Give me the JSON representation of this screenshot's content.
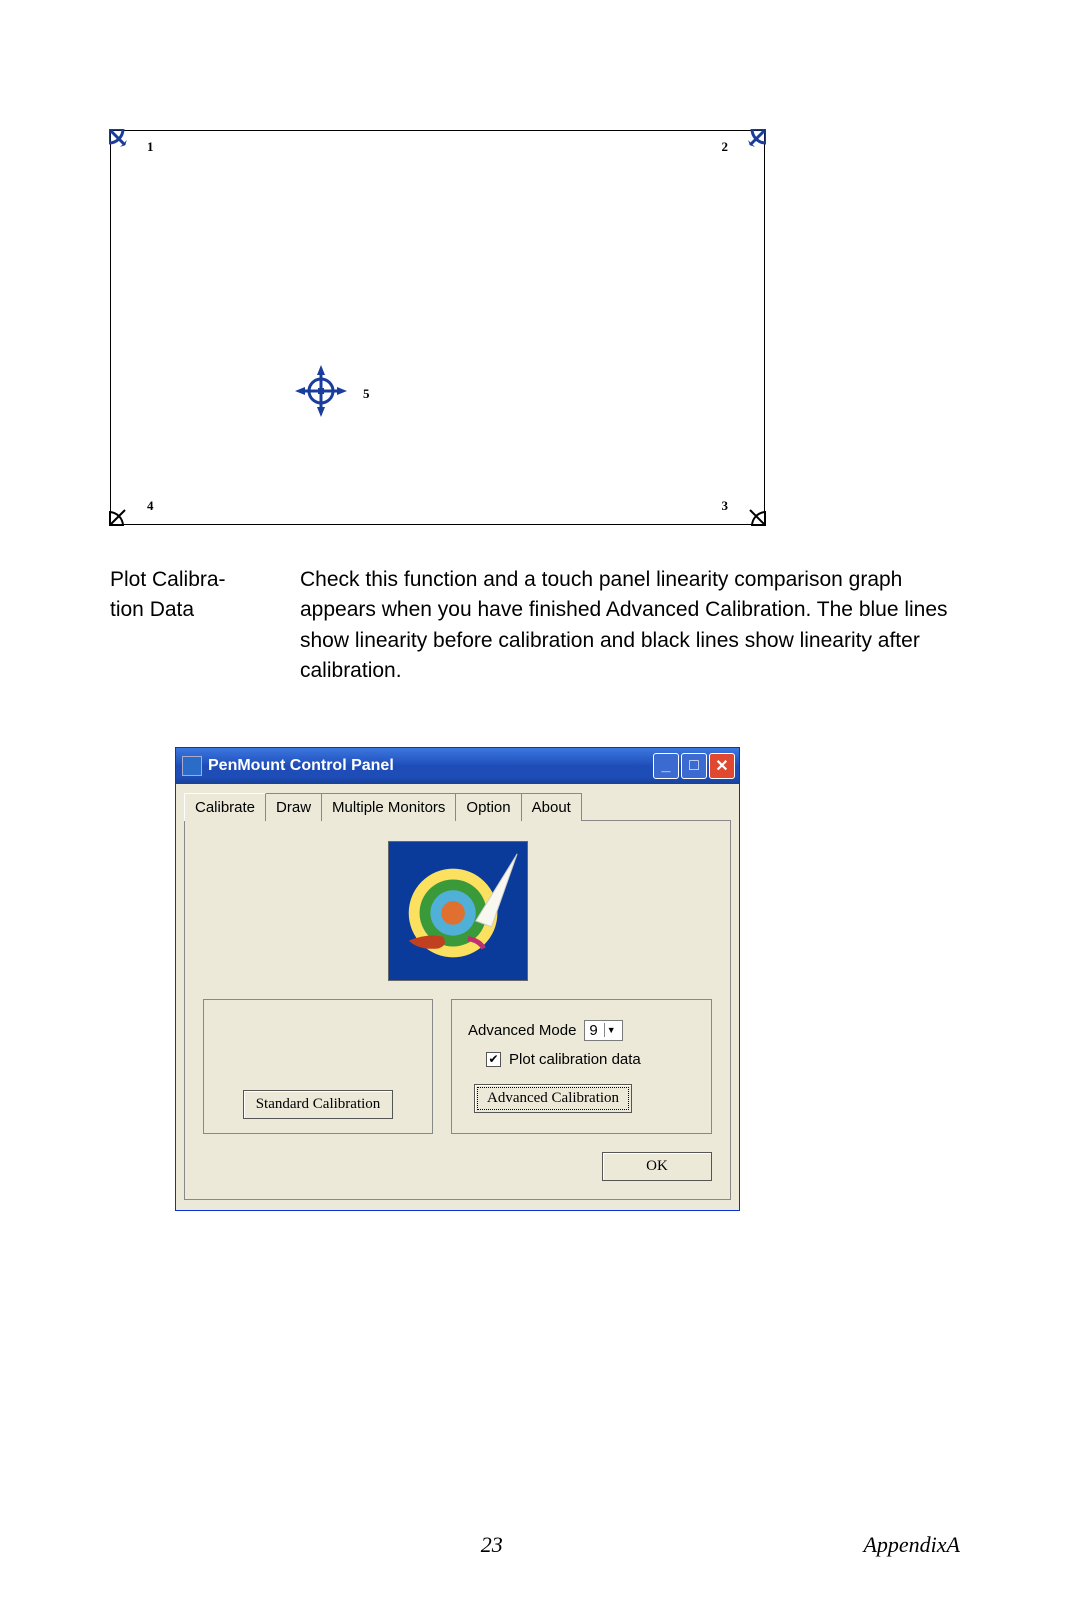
{
  "calibration_points": {
    "p1": "1",
    "p2": "2",
    "p3": "3",
    "p4": "4",
    "p5": "5"
  },
  "definition": {
    "term": "Plot Calibra-\ntion Data",
    "desc": "Check this function and a touch panel linearity comparison graph appears when you have finished Advanced Calibration. The blue lines show linearity before calibration and black lines show linearity after calibration."
  },
  "window": {
    "title": "PenMount Control Panel",
    "tabs": {
      "calibrate": "Calibrate",
      "draw": "Draw",
      "multiple": "Multiple Monitors",
      "option": "Option",
      "about": "About"
    },
    "advanced_mode_label": "Advanced Mode",
    "advanced_mode_value": "9",
    "plot_checkbox_label": "Plot calibration data",
    "plot_checkbox_checked": true,
    "standard_btn": "Standard Calibration",
    "advanced_btn": "Advanced Calibration",
    "ok_btn": "OK"
  },
  "footer": {
    "page": "23",
    "section": "AppendixA"
  }
}
